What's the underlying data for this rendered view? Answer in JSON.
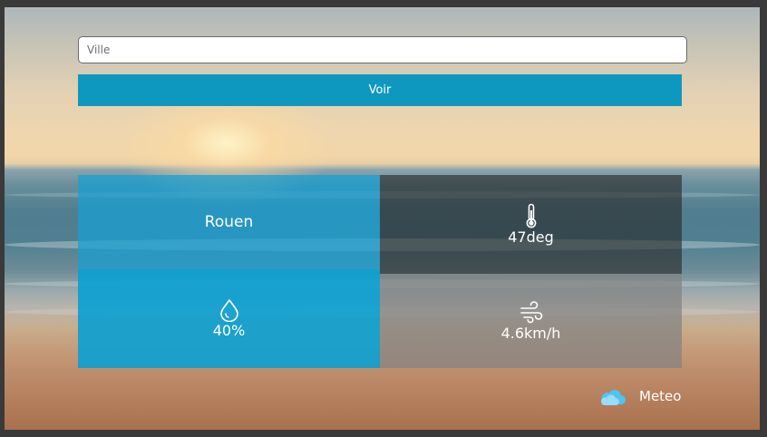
{
  "search": {
    "placeholder": "Ville",
    "value": ""
  },
  "actions": {
    "submit_label": "Voir"
  },
  "weather": {
    "city": "Rouen",
    "temperature": "47deg",
    "humidity": "40%",
    "wind": "4.6km/h"
  },
  "icons": {
    "temperature": "thermometer-icon",
    "humidity": "water-drop-icon",
    "wind": "wind-icon",
    "brand": "cloud-icon"
  },
  "footer": {
    "brand_label": "Meteo"
  },
  "colors": {
    "accent": "#0e98c0",
    "city_tile": "#17a0d2",
    "humidity_tile": "#0aa0d2",
    "temp_tile": "#282828",
    "wind_tile": "#828282",
    "brand_cloud": "#4fc3f7"
  }
}
